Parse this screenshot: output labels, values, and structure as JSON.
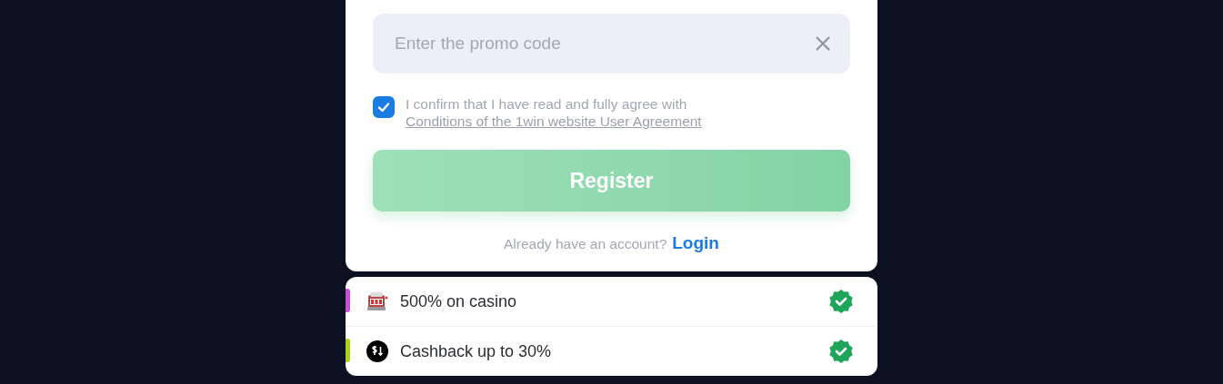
{
  "promo_field": {
    "placeholder": "Enter the promo code"
  },
  "agreement": {
    "checked": true,
    "text": "I confirm that I have read and fully agree with",
    "link": "Conditions of the 1win website User Agreement"
  },
  "register_button": {
    "label": "Register"
  },
  "login_prompt": {
    "text": "Already have an account?",
    "link": "Login"
  },
  "bonuses": [
    {
      "kind": "slot",
      "label": "500% on casino",
      "color": "#c64fd6",
      "verified": true
    },
    {
      "kind": "cashback",
      "label": "Cashback up to 30%",
      "color": "#a9d21c",
      "verified": true
    }
  ]
}
